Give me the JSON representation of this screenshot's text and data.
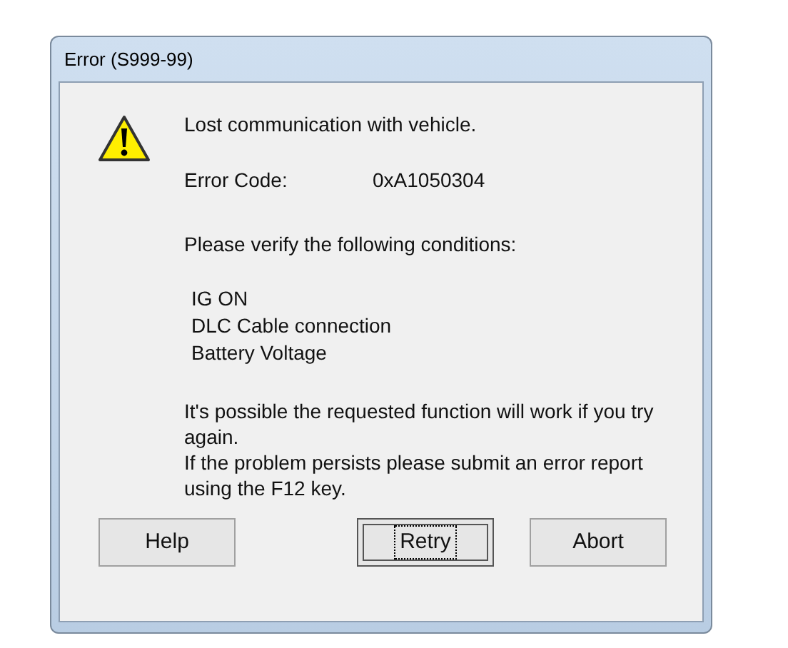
{
  "window": {
    "title": "Error (S999-99)"
  },
  "message": "Lost communication with vehicle.",
  "error_code": {
    "label": "Error Code:",
    "value": "0xA1050304"
  },
  "conditions_intro": "Please verify the following conditions:",
  "conditions": [
    "IG ON",
    "DLC Cable connection",
    "Battery Voltage"
  ],
  "notes": [
    "It's possible the requested function will work if you try again.",
    "If the problem persists please submit an error report using the F12 key."
  ],
  "buttons": [
    {
      "label": "Help",
      "focused": false
    },
    {
      "label": "Retry",
      "focused": true
    },
    {
      "label": "Abort",
      "focused": false
    }
  ]
}
